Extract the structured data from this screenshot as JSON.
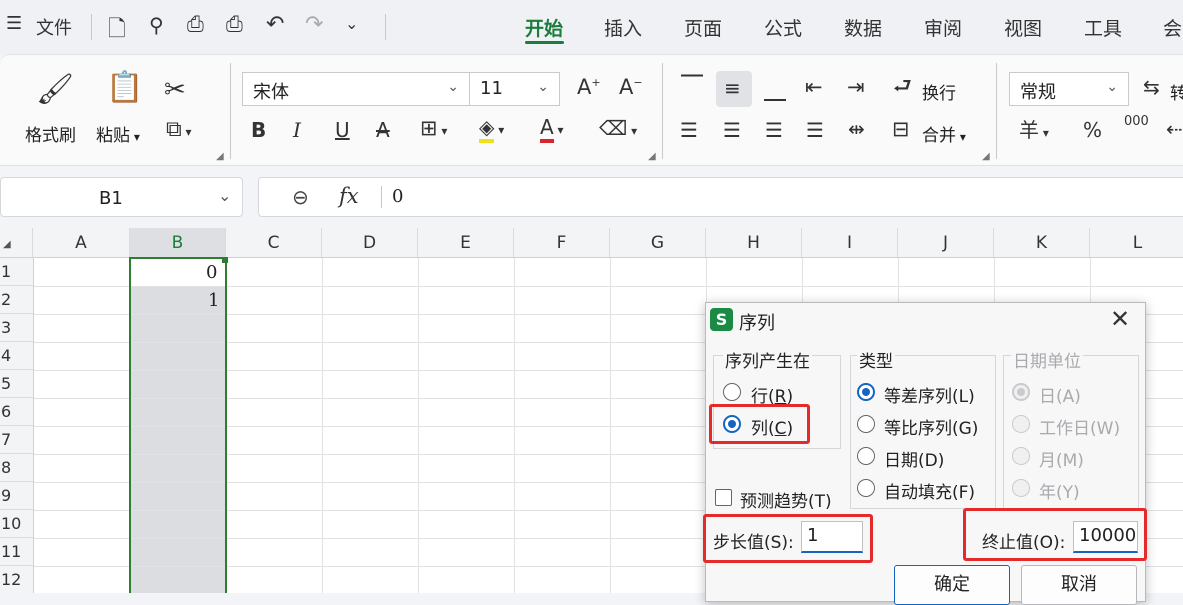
{
  "menubar": {
    "menu_icon": "hamburger-icon",
    "file_label": "文件",
    "quick_icons": [
      "save-icon",
      "format-painter-icon",
      "print-icon",
      "print-preview-icon",
      "undo-icon",
      "redo-icon",
      "chevron-down-icon"
    ],
    "tabs": [
      {
        "label": "开始",
        "active": true
      },
      {
        "label": "插入"
      },
      {
        "label": "页面"
      },
      {
        "label": "公式"
      },
      {
        "label": "数据"
      },
      {
        "label": "审阅"
      },
      {
        "label": "视图"
      },
      {
        "label": "工具"
      },
      {
        "label": "会"
      }
    ]
  },
  "ribbon": {
    "format_painter": "格式刷",
    "paste": "粘贴",
    "font_name": "宋体",
    "font_size": "11",
    "wrap_text": "换行",
    "merge": "合并",
    "number_format": "常规",
    "convert_partial": "转",
    "currency_symbol": "羊",
    "percent_symbol": "%",
    "thousands_symbol": "000"
  },
  "formula_bar": {
    "cell_ref": "B1",
    "fx_label": "fx",
    "value": "0"
  },
  "grid": {
    "columns": [
      "A",
      "B",
      "C",
      "D",
      "E",
      "F",
      "G",
      "H",
      "I",
      "J",
      "K",
      "L"
    ],
    "selected_column": "B",
    "rows": [
      "1",
      "2",
      "3",
      "4",
      "5",
      "6",
      "7",
      "8",
      "9",
      "10",
      "11",
      "12"
    ],
    "cells": {
      "B1": "0",
      "B2": "1"
    }
  },
  "dialog": {
    "app_badge": "S",
    "title": "序列",
    "series_in": {
      "label": "序列产生在",
      "row": "行(R)",
      "row_key": "R",
      "column": "列(C)",
      "column_key": "C",
      "selected": "column"
    },
    "type": {
      "label": "类型",
      "options": [
        "等差序列(L)",
        "等比序列(G)",
        "日期(D)",
        "自动填充(F)"
      ],
      "selected": 0
    },
    "date_unit": {
      "label": "日期单位",
      "options": [
        "日(A)",
        "工作日(W)",
        "月(M)",
        "年(Y)"
      ],
      "selected": 0,
      "disabled": true
    },
    "trend": {
      "label": "预测趋势(T)",
      "checked": false
    },
    "step": {
      "label": "步长值(S):",
      "value": "1"
    },
    "stop": {
      "label": "终止值(O):",
      "value": "10000"
    },
    "ok": "确定",
    "cancel": "取消"
  },
  "colors": {
    "accent_green": "#1a7d3c",
    "highlight_red": "#e42a2a",
    "focus_blue": "#1565c0"
  }
}
